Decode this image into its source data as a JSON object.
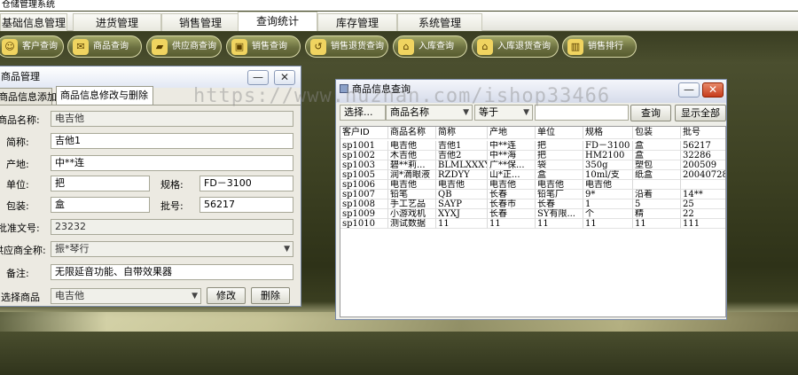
{
  "app": {
    "title": "仓储管理系统"
  },
  "menu": {
    "tabs": [
      "基础信息管理",
      "进货管理",
      "销售管理",
      "查询统计",
      "库存管理",
      "系统管理"
    ],
    "active": "查询统计"
  },
  "toolbar": {
    "buttons": [
      {
        "label": "客户查询",
        "icon": "person-icon"
      },
      {
        "label": "商品查询",
        "icon": "chat-icon"
      },
      {
        "label": "供应商查询",
        "icon": "truck-icon"
      },
      {
        "label": "销售查询",
        "icon": "cart-icon"
      },
      {
        "label": "销售退货查询",
        "icon": "return-icon"
      },
      {
        "label": "入库查询",
        "icon": "house-icon"
      },
      {
        "label": "入库退货查询",
        "icon": "house-return-icon"
      },
      {
        "label": "销售排行",
        "icon": "bar-chart-icon"
      }
    ]
  },
  "product_window": {
    "title": "商品管理",
    "tabs": [
      "商品信息添加",
      "商品信息修改与删除"
    ],
    "labels": {
      "name": "商品名称:",
      "short": "简称:",
      "origin": "产地:",
      "unit": "单位:",
      "spec": "规格:",
      "pack": "包装:",
      "batch": "批号:",
      "approval": "批准文号:",
      "supplier": "供应商全称:",
      "note": "备注:",
      "select": "选择商品"
    },
    "values": {
      "name": "电吉他",
      "short": "吉他1",
      "origin": "中**连",
      "unit": "把",
      "spec": "FD－3100",
      "pack": "盒",
      "batch": "56217",
      "approval": "23232",
      "supplier": "振*琴行",
      "note": "无限延音功能、自带效果器",
      "select": "电吉他"
    },
    "buttons": {
      "modify": "修改",
      "delete": "删除"
    }
  },
  "query_window": {
    "title": "商品信息查询",
    "select_label": "选择...",
    "field": "商品名称",
    "operator": "等于",
    "search_value": "",
    "query_button": "查询",
    "show_all_button": "显示全部",
    "columns": [
      "客户ID",
      "商品名称",
      "简称",
      "产地",
      "单位",
      "规格",
      "包装",
      "批号"
    ],
    "rows": [
      [
        "sp1001",
        "电吉他",
        "吉他1",
        "中**连",
        "把",
        "FD－3100",
        "盒",
        "56217"
      ],
      [
        "sp1002",
        "木吉他",
        "吉他2",
        "中**海",
        "把",
        "HM2100",
        "盒",
        "32286"
      ],
      [
        "sp1003",
        "碧**莉...",
        "BLMLXXXYF",
        "广**保...",
        "袋",
        "350g",
        "塑包",
        "200509"
      ],
      [
        "sp1005",
        "润*滴眼液",
        "RZDYY",
        "山*正...",
        "盒",
        "10ml/支",
        "纸盒",
        "20040728"
      ],
      [
        "sp1006",
        "电吉他",
        "电吉他",
        "电吉他",
        "电吉他",
        "电吉他",
        "",
        ""
      ],
      [
        "sp1007",
        "铅笔",
        "QB",
        "长春",
        "铅笔厂",
        "9*",
        "沿着",
        "14**"
      ],
      [
        "sp1008",
        "手工艺品",
        "SAYP",
        "长春市",
        "长春",
        "1",
        "5",
        "25"
      ],
      [
        "sp1009",
        "小游戏机",
        "XYXJ",
        "长春",
        "SY有限...",
        "个",
        "精",
        "22"
      ],
      [
        "sp1010",
        "测试数据",
        "11",
        "11",
        "11",
        "11",
        "11",
        "111"
      ]
    ]
  },
  "watermark": "https://www.huzhan.com/ishop33466"
}
